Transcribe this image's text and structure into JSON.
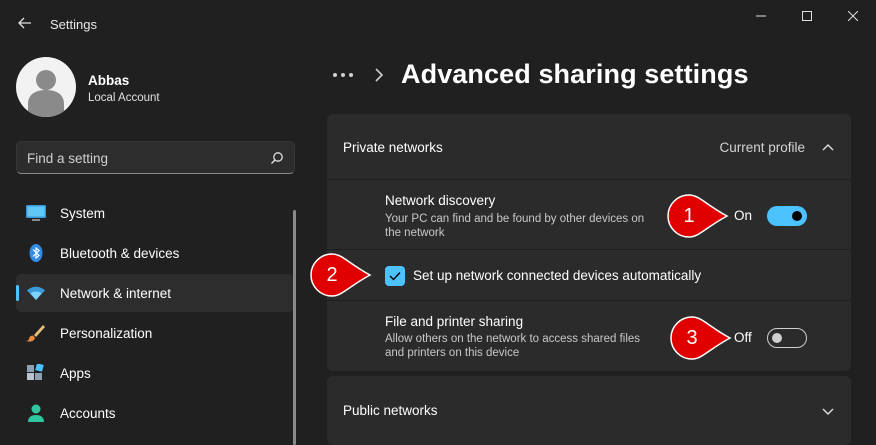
{
  "window": {
    "title": "Settings"
  },
  "profile": {
    "name": "Abbas",
    "account_type": "Local Account"
  },
  "search": {
    "placeholder": "Find a setting"
  },
  "sidebar": {
    "items": [
      {
        "label": "System",
        "icon": "monitor-icon",
        "active": false
      },
      {
        "label": "Bluetooth & devices",
        "icon": "bluetooth-icon",
        "active": false
      },
      {
        "label": "Network & internet",
        "icon": "wifi-icon",
        "active": true
      },
      {
        "label": "Personalization",
        "icon": "paintbrush-icon",
        "active": false
      },
      {
        "label": "Apps",
        "icon": "apps-icon",
        "active": false
      },
      {
        "label": "Accounts",
        "icon": "person-icon",
        "active": false
      }
    ]
  },
  "header": {
    "title": "Advanced sharing settings"
  },
  "private_networks": {
    "title": "Private networks",
    "status": "Current profile",
    "expanded": true,
    "network_discovery": {
      "title": "Network discovery",
      "description": "Your PC can find and be found by other devices on the network",
      "state_label": "On",
      "on": true
    },
    "auto_setup": {
      "label": "Set up network connected devices automatically",
      "checked": true
    },
    "file_printer_sharing": {
      "title": "File and printer sharing",
      "description": "Allow others on the network to access shared files and printers on this device",
      "state_label": "Off",
      "on": false
    }
  },
  "public_networks": {
    "title": "Public networks",
    "expanded": false
  },
  "annotations": [
    "1",
    "2",
    "3"
  ],
  "colors": {
    "accent": "#4cc2ff",
    "background": "#202020",
    "card": "#2b2b2b",
    "marker": "#e00000"
  }
}
